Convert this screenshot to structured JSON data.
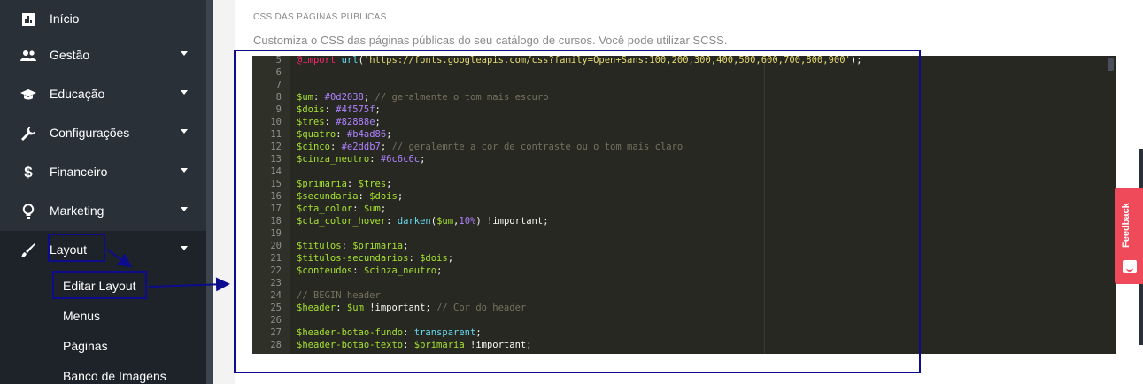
{
  "sidebar": {
    "items": [
      {
        "label": "Início",
        "icon": "bar-chart-icon",
        "has_caret": false
      },
      {
        "label": "Gestão",
        "icon": "people-icon",
        "has_caret": true
      },
      {
        "label": "Educação",
        "icon": "graduation-cap-icon",
        "has_caret": true
      },
      {
        "label": "Configurações",
        "icon": "wrench-icon",
        "has_caret": true
      },
      {
        "label": "Financeiro",
        "icon": "dollar-icon",
        "has_caret": true
      },
      {
        "label": "Marketing",
        "icon": "lightbulb-icon",
        "has_caret": true
      },
      {
        "label": "Layout",
        "icon": "brush-icon",
        "has_caret": true
      }
    ],
    "subitems": [
      {
        "label": "Editar Layout"
      },
      {
        "label": "Menus"
      },
      {
        "label": "Páginas"
      },
      {
        "label": "Banco de Imagens"
      }
    ]
  },
  "main": {
    "section_title": "CSS DAS PÁGINAS PÚBLICAS",
    "section_description": "Customiza o CSS das páginas públicas do seu catálogo de cursos. Você pode utilizar SCSS."
  },
  "editor": {
    "lines": [
      {
        "n": "5",
        "code": "@import url('https://fonts.googleapis.com/css?family=Open+Sans:100,200,300,400,500,600,700,800,900');"
      },
      {
        "n": "6",
        "code": ""
      },
      {
        "n": "7",
        "code": ""
      },
      {
        "n": "8",
        "code": "$um: #0d2038; // geralmente o tom mais escuro"
      },
      {
        "n": "9",
        "code": "$dois: #4f575f;"
      },
      {
        "n": "10",
        "code": "$tres: #82888e;"
      },
      {
        "n": "11",
        "code": "$quatro: #b4ad86;"
      },
      {
        "n": "12",
        "code": "$cinco: #e2ddb7; // geralemnte a cor de contraste ou o tom mais claro"
      },
      {
        "n": "13",
        "code": "$cinza_neutro: #6c6c6c;"
      },
      {
        "n": "14",
        "code": ""
      },
      {
        "n": "15",
        "code": "$primaria: $tres;"
      },
      {
        "n": "16",
        "code": "$secundaria: $dois;"
      },
      {
        "n": "17",
        "code": "$cta_color: $um;"
      },
      {
        "n": "18",
        "code": "$cta_color_hover: darken($um,10%) !important;"
      },
      {
        "n": "19",
        "code": ""
      },
      {
        "n": "20",
        "code": "$titulos: $primaria;"
      },
      {
        "n": "21",
        "code": "$titulos-secundarios: $dois;"
      },
      {
        "n": "22",
        "code": "$conteudos: $cinza_neutro;"
      },
      {
        "n": "23",
        "code": ""
      },
      {
        "n": "24",
        "code": "// BEGIN header"
      },
      {
        "n": "25",
        "code": "$header: $um !important; // Cor do header"
      },
      {
        "n": "26",
        "code": ""
      },
      {
        "n": "27",
        "code": "$header-botao-fundo: transparent;"
      },
      {
        "n": "28",
        "code": "$header-botao-texto: $primaria !important;"
      }
    ]
  },
  "feedback": {
    "label": "Feedback"
  },
  "colors": {
    "sidebar_bg": "#2a3038",
    "annotation": "#0c0c8c",
    "feedback_bg": "#ef4a5a",
    "editor_bg": "#272822"
  }
}
